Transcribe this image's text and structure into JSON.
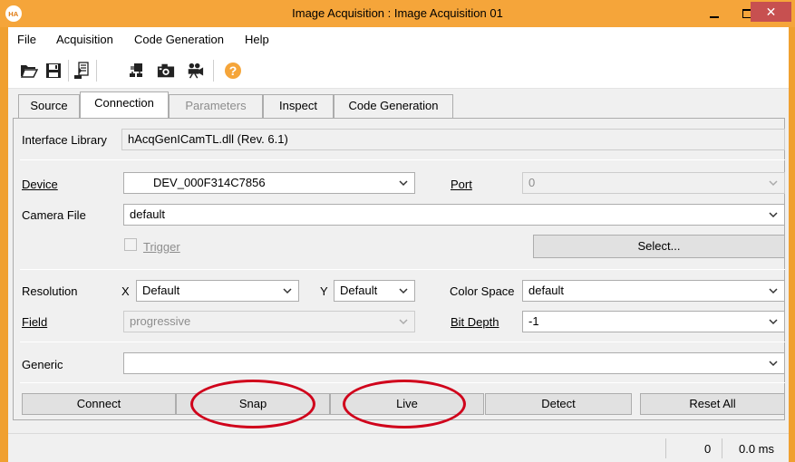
{
  "window": {
    "title": "Image Acquisition : Image Acquisition 01",
    "app_icon_text": "HA",
    "accent_color": "#f5a53a"
  },
  "menu": [
    "File",
    "Acquisition",
    "Code Generation",
    "Help"
  ],
  "toolbar_icons": [
    "open-folder-icon",
    "save-icon",
    "export-icon",
    "connect-icon",
    "camera-icon",
    "live-video-icon",
    "help-icon"
  ],
  "tabs": {
    "source": "Source",
    "connection": "Connection",
    "parameters": "Parameters",
    "inspect": "Inspect",
    "code_generation": "Code Generation",
    "active": "Connection"
  },
  "connection": {
    "interface_library_label": "Interface Library",
    "interface_library_value": "hAcqGenICamTL.dll (Rev. 6.1)",
    "device_label": "Device",
    "device_value": "DEV_000F314C7856",
    "port_label": "Port",
    "port_value": "0",
    "camera_file_label": "Camera File",
    "camera_file_value": "default",
    "trigger_label": "Trigger",
    "select_button": "Select...",
    "resolution_label": "Resolution",
    "x_label": "X",
    "x_value": "Default",
    "y_label": "Y",
    "y_value": "Default",
    "color_space_label": "Color Space",
    "color_space_value": "default",
    "field_label": "Field",
    "field_value": "progressive",
    "bit_depth_label": "Bit Depth",
    "bit_depth_value": "-1",
    "generic_label": "Generic",
    "generic_value": ""
  },
  "buttons": {
    "connect": "Connect",
    "snap": "Snap",
    "live": "Live",
    "detect": "Detect",
    "reset_all": "Reset All"
  },
  "status": {
    "count": "0",
    "time": "0.0 ms"
  }
}
